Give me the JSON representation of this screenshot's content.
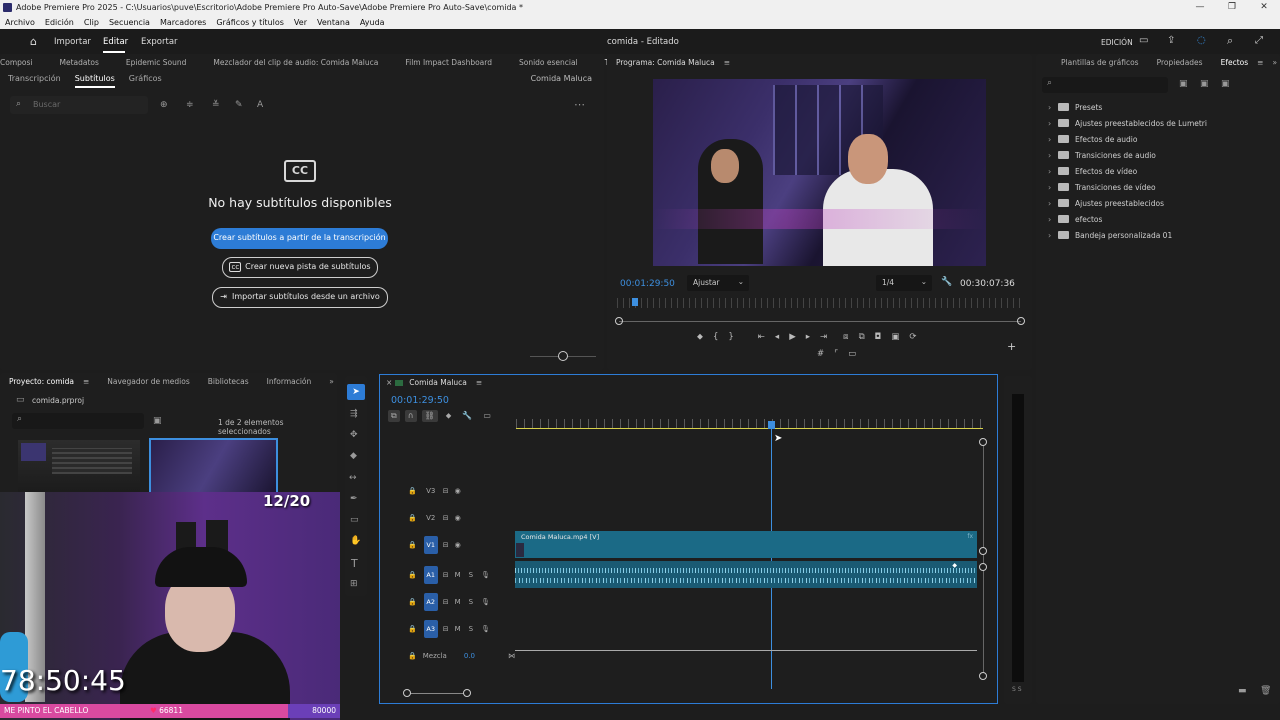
{
  "window": {
    "title": "Adobe Premiere Pro 2025 - C:\\Usuarios\\puve\\Escritorio\\Adobe Premiere Pro Auto-Save\\Adobe Premiere Pro Auto-Save\\comida *",
    "controls": [
      "—",
      "❐",
      "✕"
    ]
  },
  "menu": [
    "Archivo",
    "Edición",
    "Clip",
    "Secuencia",
    "Marcadores",
    "Gráficos y títulos",
    "Ver",
    "Ventana",
    "Ayuda"
  ],
  "appbar": {
    "tabs": [
      "Importar",
      "Editar",
      "Exportar"
    ],
    "active_tab": "Editar",
    "project_status": "comida - Editado",
    "workspace": "EDICIÓN"
  },
  "left_panel": {
    "tabs": [
      "Composi",
      "Metadatos",
      "Epidemic Sound",
      "Mezclador del clip de audio: Comida Maluca",
      "Film Impact Dashboard",
      "Sonido esencial",
      "Texto"
    ],
    "active_tab": "Texto",
    "subtabs": [
      "Transcripción",
      "Subtítulos",
      "Gráficos"
    ],
    "active_subtab": "Subtítulos",
    "sequence_name": "Comida Maluca",
    "search_placeholder": "Buscar",
    "cc_label": "CC",
    "empty_title": "No hay subtítulos disponibles",
    "btn_transcribe": "Crear subtítulos a partir de la transcripción",
    "btn_new_track": "Crear nueva pista de subtítulos",
    "btn_import": "Importar subtítulos desde un archivo"
  },
  "program_monitor": {
    "title": "Programa: Comida Maluca",
    "timecode_current": "00:01:29:50",
    "fit": "Ajustar",
    "resolution": "1/4",
    "timecode_duration": "00:30:07:36"
  },
  "effects_panel": {
    "tabs": [
      "Plantillas de gráficos",
      "Propiedades",
      "Efectos"
    ],
    "active_tab": "Efectos",
    "items": [
      "Presets",
      "Ajustes preestablecidos de Lumetri",
      "Efectos de audio",
      "Transiciones de audio",
      "Efectos de vídeo",
      "Transiciones de vídeo",
      "Ajustes preestablecidos",
      "efectos",
      "Bandeja personalizada 01"
    ]
  },
  "project_panel": {
    "tabs": [
      "Proyecto: comida",
      "Navegador de medios",
      "Bibliotecas",
      "Información"
    ],
    "active_tab": "Proyecto: comida",
    "file": "comida.prproj",
    "selection_info": "1 de 2 elementos seleccionados"
  },
  "timeline": {
    "sequence": "Comida Maluca",
    "timecode": "00:01:29:50",
    "tracks": [
      {
        "name": "V3",
        "type": "video"
      },
      {
        "name": "V2",
        "type": "video"
      },
      {
        "name": "V1",
        "type": "video",
        "active": true
      },
      {
        "name": "A1",
        "type": "audio",
        "active": true
      },
      {
        "name": "A2",
        "type": "audio",
        "active": true
      },
      {
        "name": "A3",
        "type": "audio",
        "active": true
      }
    ],
    "mix_label": "Mezcla",
    "mix_value": "0.0",
    "clip_label": "Comida Maluca.mp4 [V]",
    "audio_ms": [
      "M",
      "S"
    ]
  },
  "webcam_overlay": {
    "counter": "12/20",
    "timer": "78:50:45",
    "ticker_left": "ME PINTO EL CABELLO",
    "ticker_mid": "66811",
    "ticker_right": "80000"
  },
  "colors": {
    "accent": "#2d7cd6",
    "clip_video": "#1b6a86",
    "clip_audio": "#1a5a73",
    "playhead": "#3d8fdf",
    "ticker_pink": "#d94aa0",
    "ticker_purple": "#6b3fb8"
  }
}
